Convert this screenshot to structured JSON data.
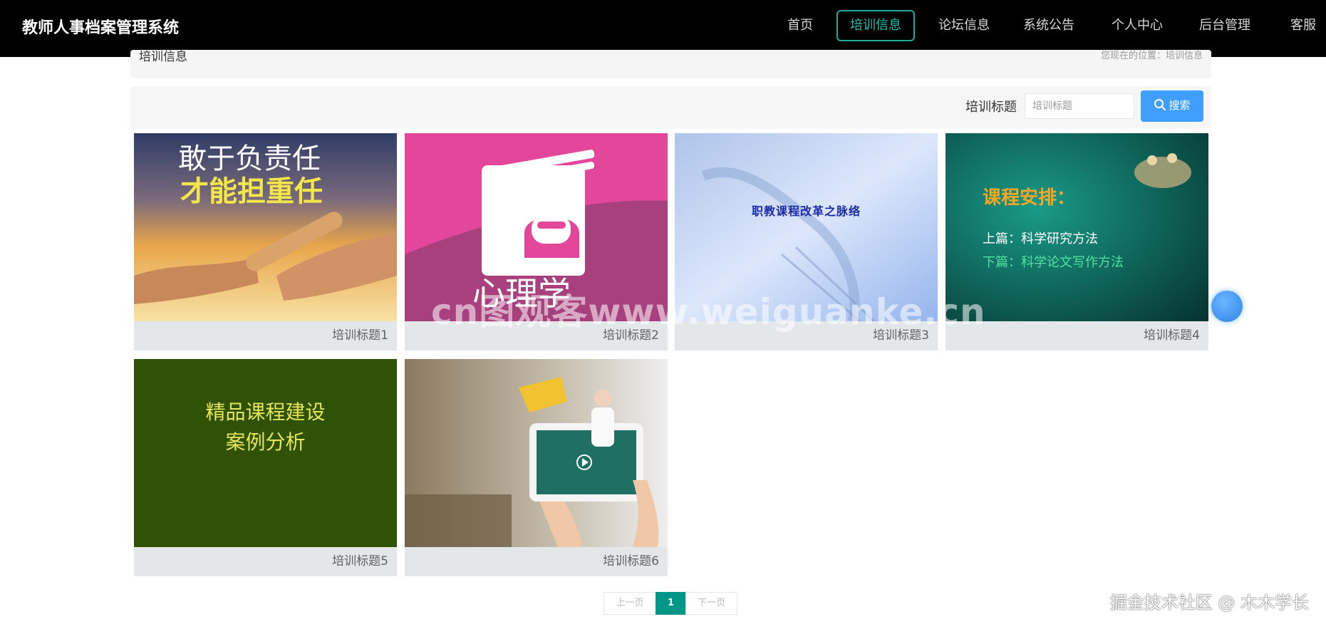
{
  "header": {
    "brand": "教师人事档案管理系统",
    "nav": [
      "首页",
      "培训信息",
      "论坛信息",
      "系统公告",
      "个人中心",
      "后台管理",
      "客服"
    ],
    "active_nav": "培训信息"
  },
  "breadcrumb": {
    "title": "培训信息",
    "location": "您现在的位置：培训信息"
  },
  "search": {
    "label": "培训标题",
    "placeholder": "培训标题",
    "button_label": "搜索"
  },
  "cards": [
    {
      "title": "培训标题1",
      "image_text": [
        "敢于负责任",
        "才能担重任"
      ]
    },
    {
      "title": "培训标题2",
      "image_text": [
        "心理学"
      ]
    },
    {
      "title": "培训标题3",
      "image_text": [
        "职教课程改革之脉络"
      ]
    },
    {
      "title": "培训标题4",
      "image_text": [
        "课程安排：",
        "上篇：科学研究方法",
        "下篇：科学论文写作方法"
      ]
    },
    {
      "title": "培训标题5",
      "image_text": [
        "精品课程建设",
        "案例分析"
      ]
    },
    {
      "title": "培训标题6",
      "image_text": []
    }
  ],
  "pagination": {
    "prev": "上一页",
    "current": "1",
    "next": "下一页"
  },
  "overlays": {
    "watermark": "cn图观客www.weiguanke.cn",
    "footer_mark": "掘金技术社区 @ 木木学长"
  },
  "colors": {
    "navbar": "#000000",
    "active_nav": "#23a898",
    "search_button": "#409eff",
    "page_current": "#009688"
  }
}
